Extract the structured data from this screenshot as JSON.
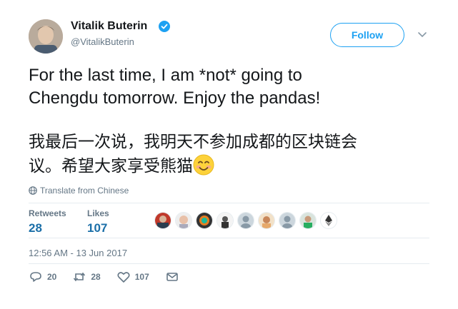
{
  "author": {
    "name": "Vitalik Buterin",
    "handle": "@VitalikButerin",
    "verified_icon": "verified-badge-icon"
  },
  "follow_label": "Follow",
  "tweet": {
    "text_en": "For the last time, I am *not* going to\nChengdu tomorrow. Enjoy the pandas!",
    "text_cn": "我最后一次说，我明天不参加成都的区块链会\n议。希望大家享受熊猫",
    "emoji": "smiling-face-emoji"
  },
  "translate_label": "Translate from Chinese",
  "stats": {
    "retweets_label": "Retweets",
    "retweets_count": "28",
    "likes_label": "Likes",
    "likes_count": "107"
  },
  "timestamp": "12:56 AM - 13 Jun 2017",
  "actions": {
    "reply_count": "20",
    "retweet_count": "28",
    "like_count": "107"
  },
  "colors": {
    "accent": "#1da1f2",
    "stat_value": "#1b6fa8",
    "secondary_text": "#657786",
    "divider": "#e6ecf0"
  }
}
